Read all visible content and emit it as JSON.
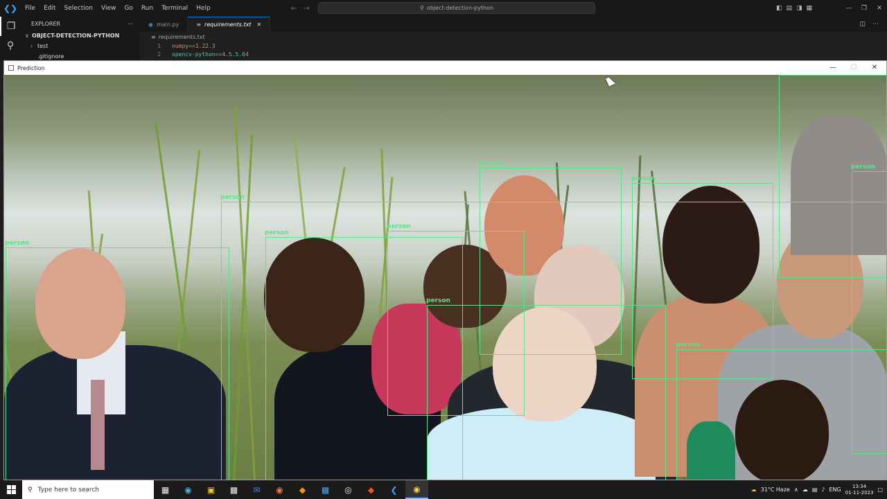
{
  "menu": [
    "File",
    "Edit",
    "Selection",
    "View",
    "Go",
    "Run",
    "Terminal",
    "Help"
  ],
  "command_center": "object-detection-python",
  "explorer": {
    "title": "EXPLORER",
    "project": "OBJECT-DETECTION-PYTHON",
    "items": [
      "test",
      ".gitignore"
    ]
  },
  "tabs": [
    {
      "label": "main.py",
      "active": false
    },
    {
      "label": "requirements.txt",
      "active": true
    }
  ],
  "breadcrumb": "requirements.txt",
  "code": [
    {
      "num": "1",
      "text": "numpy==1.22.3"
    },
    {
      "num": "2",
      "text": "opencv-python==4.5.5.64"
    }
  ],
  "prediction_window": {
    "title": "Prediction",
    "detections": [
      {
        "label": "person"
      },
      {
        "label": "person"
      },
      {
        "label": "person"
      },
      {
        "label": "person"
      },
      {
        "label": "person"
      },
      {
        "label": "person"
      },
      {
        "label": "person"
      },
      {
        "label": "person"
      },
      {
        "label": "person"
      },
      {
        "label": "person"
      }
    ]
  },
  "taskbar": {
    "search_placeholder": "Type here to search",
    "weather": "31°C  Haze",
    "language": "ENG",
    "time": "13:34",
    "date": "01-11-2023"
  },
  "colors": {
    "bbox": "#5de28a",
    "vscode_bg": "#1e1e1e",
    "accent": "#0078d4"
  }
}
